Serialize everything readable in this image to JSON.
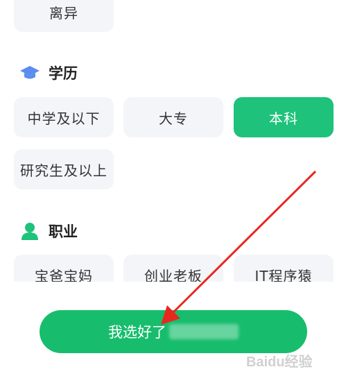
{
  "marital": {
    "options": [
      {
        "label": "离异"
      }
    ]
  },
  "education": {
    "title": "学历",
    "icon": "graduation-cap-icon",
    "options": [
      {
        "label": "中学及以下",
        "selected": false
      },
      {
        "label": "大专",
        "selected": false
      },
      {
        "label": "本科",
        "selected": true
      },
      {
        "label": "研究生及以上",
        "selected": false
      }
    ]
  },
  "occupation": {
    "title": "职业",
    "icon": "person-icon",
    "options": [
      {
        "label": "宝爸宝妈"
      },
      {
        "label": "创业老板"
      },
      {
        "label": "IT程序猿"
      }
    ]
  },
  "confirm": {
    "label": "我选好了"
  },
  "watermark": {
    "text": "Baidu经验"
  },
  "colors": {
    "accent": "#1ec27a",
    "chip_bg": "#f4f5f8",
    "education_icon": "#5b8def",
    "occupation_icon": "#1ec27a",
    "arrow": "#e8281e"
  }
}
